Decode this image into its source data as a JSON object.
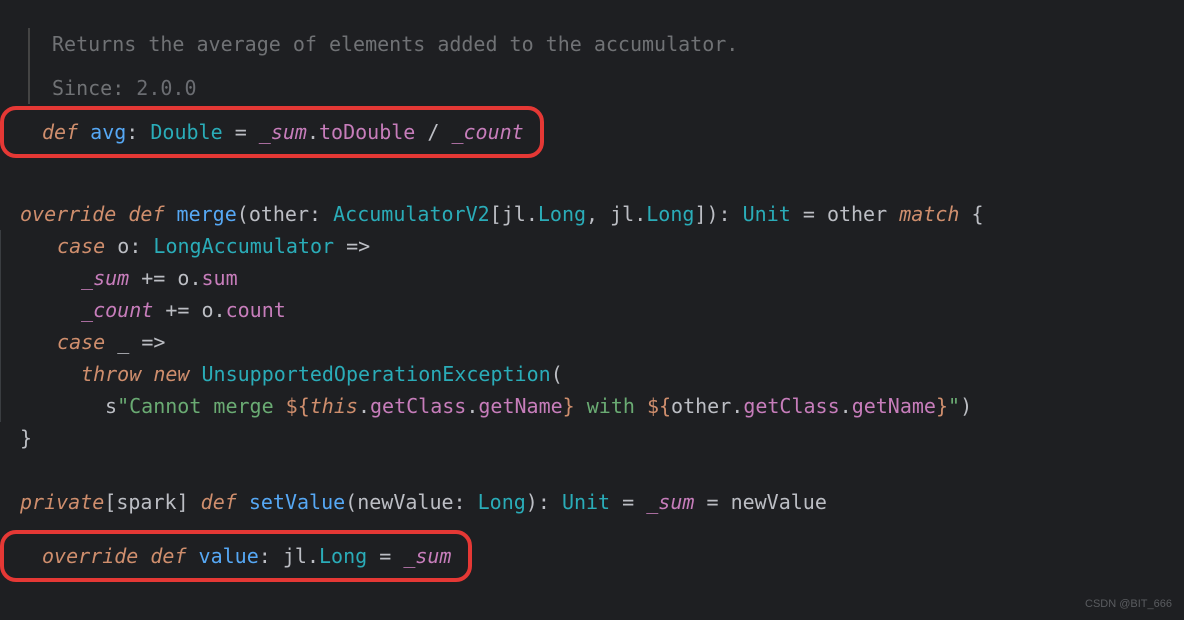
{
  "doc": {
    "description": "Returns the average of elements added to the accumulator.",
    "since_label": "Since:",
    "since_value": "2.0.0"
  },
  "code": {
    "def": "def",
    "override": "override",
    "private": "private",
    "case": "case",
    "throw": "throw",
    "new": "new",
    "this": "this",
    "match": "match",
    "avg": "avg",
    "merge": "merge",
    "setValue": "setValue",
    "value": "value",
    "Double": "Double",
    "AccumulatorV2": "AccumulatorV2",
    "jl": "jl",
    "Long": "Long",
    "LongAccumulator": "LongAccumulator",
    "Unit": "Unit",
    "UnsupportedOperationException": "UnsupportedOperationException",
    "_sum": "_sum",
    "_count": "_count",
    "toDouble": "toDouble",
    "other": "other",
    "o": "o",
    "sum": "sum",
    "count": "count",
    "spark": "spark",
    "newValue": "newValue",
    "getClass": "getClass",
    "getName": "getName",
    "s_prefix": "s",
    "str1": "\"Cannot merge ",
    "str2": " with ",
    "str3": "\"",
    "interp_open": "${",
    "interp_close": "}",
    "colon": ":",
    "eq": "=",
    "dot": ".",
    "slash": "/",
    "comma": ",",
    "lparen": "(",
    "rparen": ")",
    "lbracket": "[",
    "rbracket": "]",
    "lbrace": "{",
    "rbrace": "}",
    "arrow": "=>",
    "pluseq": "+=",
    "underscore": "_"
  },
  "watermark": "CSDN @BIT_666"
}
